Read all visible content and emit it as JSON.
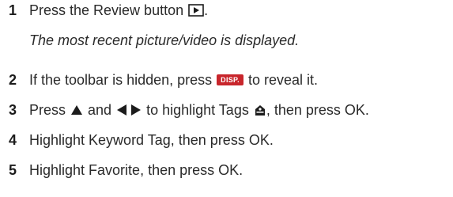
{
  "steps": [
    {
      "number": "1",
      "text_before": "Press the Review button",
      "icon": "review-play-icon",
      "text_after": ".",
      "note": "The most recent picture/video is displayed."
    },
    {
      "number": "2",
      "text_before": "If the toolbar is hidden, press",
      "button_label": "DISP.",
      "text_after": "to reveal it."
    },
    {
      "number": "3",
      "text_before": "Press",
      "icon_up": "up-arrow-icon",
      "text_mid": "and",
      "icon_lr": "left-right-arrows-icon",
      "text_mid2": "to highlight Tags",
      "icon_tag": "tag-icon",
      "text_after": ", then press OK."
    },
    {
      "number": "4",
      "text": "Highlight Keyword Tag, then press OK."
    },
    {
      "number": "5",
      "text": "Highlight Favorite, then press OK."
    }
  ],
  "colors": {
    "text": "#2a2a2a",
    "disp_button": "#c8262c"
  }
}
